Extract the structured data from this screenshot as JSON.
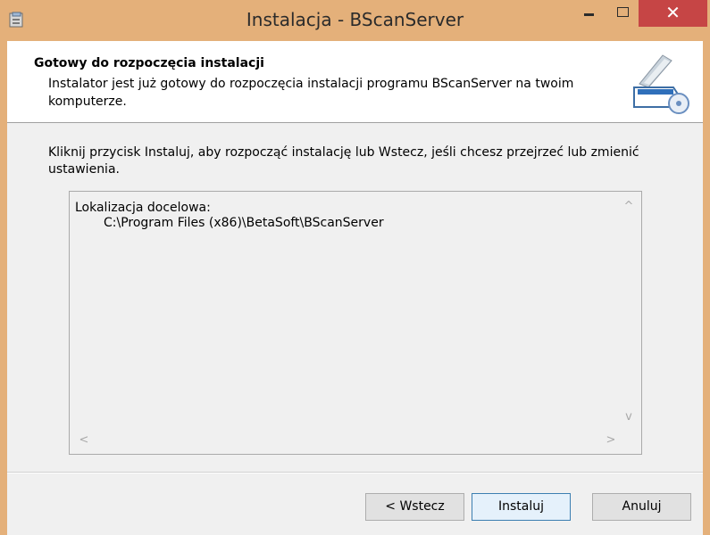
{
  "window": {
    "title": "Instalacja - BScanServer",
    "close_glyph": "✕"
  },
  "header": {
    "title": "Gotowy do rozpoczęcia instalacji",
    "subtitle": "Instalator jest już gotowy do rozpoczęcia instalacji programu BScanServer na twoim komputerze.",
    "icon": "scanner-icon"
  },
  "body": {
    "instruction": "Kliknij przycisk Instaluj, aby rozpocząć instalację lub Wstecz, jeśli chcesz przejrzeć lub zmienić ustawienia.",
    "memo": {
      "label": "Lokalizacja docelowa:",
      "path": "C:\\Program Files (x86)\\BetaSoft\\BScanServer"
    },
    "scroll_glyphs": {
      "up": "^",
      "down": "v",
      "left": "<",
      "right": ">"
    }
  },
  "buttons": {
    "back": "< Wstecz",
    "install": "Instaluj",
    "cancel": "Anuluj"
  },
  "colors": {
    "titlebar": "#e4b07a",
    "close": "#c64545",
    "client": "#f0f0f0",
    "default_button_border": "#3c7fb1"
  }
}
